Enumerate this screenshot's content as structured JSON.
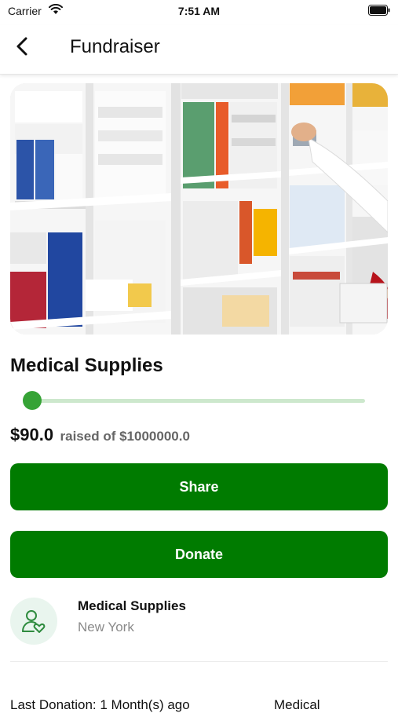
{
  "status_bar": {
    "carrier": "Carrier",
    "time": "7:51 AM",
    "icons": [
      "wifi-icon",
      "battery-icon"
    ]
  },
  "nav": {
    "title": "Fundraiser",
    "back_icon": "chevron-left-icon"
  },
  "campaign": {
    "title": "Medical Supplies",
    "raised": "$90.0",
    "goal_text": "raised of $1000000.0",
    "progress_fraction": 9e-05
  },
  "buttons": {
    "share_label": "Share",
    "donate_label": "Donate"
  },
  "organization": {
    "name": "Medical Supplies",
    "location": "New York",
    "icon": "person-heart-icon"
  },
  "details": {
    "last_donation": "Last Donation: 1 Month(s) ago",
    "category": "Medical"
  },
  "colors": {
    "primary_green": "#007b00",
    "slider_thumb": "#36a336",
    "slider_track": "#cde8cd",
    "avatar_bg": "#e9f5ee",
    "muted_text": "#8a8a8a"
  }
}
